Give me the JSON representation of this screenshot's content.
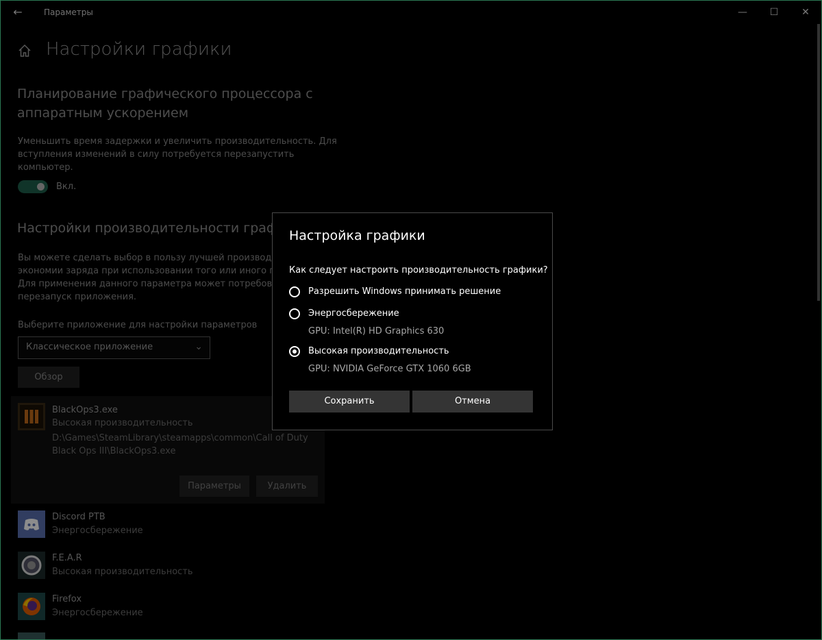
{
  "window": {
    "title": "Параметры"
  },
  "page": {
    "title": "Настройки графики"
  },
  "gpu_scheduling": {
    "heading_line1": "Планирование графического процессора с",
    "heading_line2": "аппаратным ускорением",
    "desc_line1": "Уменьшить время задержки и увеличить производительность. Для",
    "desc_line2": "вступления изменений в силу потребуется перезапустить",
    "desc_line3": "компьютер.",
    "toggle_label": "Вкл."
  },
  "performance": {
    "heading": "Настройки производительности графики",
    "desc_line1": "Вы можете сделать выбор в пользу лучшей производите",
    "desc_line2": "экономии заряда при использовании того или иного при",
    "desc_line3": "Для применения данного параметра может потребовать",
    "desc_line4": "перезапуск приложения.",
    "select_label": "Выберите приложение для настройки параметров",
    "select_value": "Классическое приложение",
    "browse_button": "Обзор"
  },
  "apps": [
    {
      "name": "BlackOps3.exe",
      "mode": "Высокая производительность",
      "path_line1": "D:\\Games\\SteamLibrary\\steamapps\\common\\Call of Duty",
      "path_line2": "Black Ops III\\BlackOps3.exe",
      "options_button": "Параметры",
      "delete_button": "Удалить"
    },
    {
      "name": "Discord PTB",
      "mode": "Энергосбережение"
    },
    {
      "name": "F.E.A.R",
      "mode": "Высокая производительность"
    },
    {
      "name": "Firefox",
      "mode": "Энергосбережение"
    }
  ],
  "dialog": {
    "title": "Настройка графики",
    "question": "Как следует настроить производительность графики?",
    "options": [
      {
        "label": "Разрешить Windows принимать решение",
        "gpu": "",
        "selected": false
      },
      {
        "label": "Энергосбережение",
        "gpu": "GPU: Intel(R) HD Graphics 630",
        "selected": false
      },
      {
        "label": "Высокая производительность",
        "gpu": "GPU: NVIDIA GeForce GTX 1060 6GB",
        "selected": true
      }
    ],
    "save_button": "Сохранить",
    "cancel_button": "Отмена"
  },
  "colors": {
    "accent": "#1e5f4b",
    "border": "#2c7a55"
  }
}
